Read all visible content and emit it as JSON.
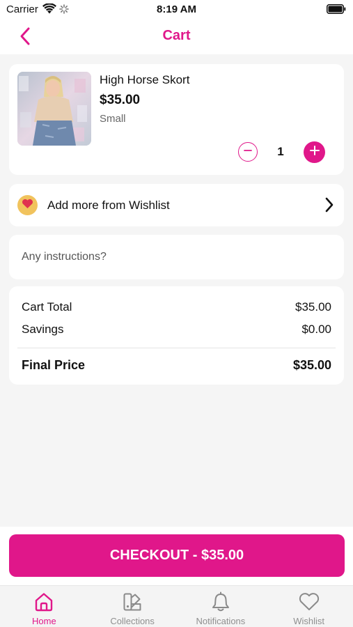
{
  "status_bar": {
    "carrier": "Carrier",
    "time": "8:19 AM"
  },
  "nav": {
    "title": "Cart",
    "back_icon": "chevron-left-icon"
  },
  "cart_item": {
    "name": "High Horse Skort",
    "price": "$35.00",
    "size": "Small",
    "quantity": "1"
  },
  "wishlist": {
    "label": "Add more from Wishlist",
    "icon": "heart-icon"
  },
  "instructions": {
    "placeholder": "Any instructions?"
  },
  "summary": {
    "cart_total_label": "Cart Total",
    "cart_total_value": "$35.00",
    "savings_label": "Savings",
    "savings_value": "$0.00",
    "final_label": "Final Price",
    "final_value": "$35.00"
  },
  "checkout": {
    "label": "CHECKOUT - $35.00"
  },
  "tabs": [
    {
      "label": "Home",
      "icon": "home-icon",
      "active": true
    },
    {
      "label": "Collections",
      "icon": "collections-icon",
      "active": false
    },
    {
      "label": "Notifications",
      "icon": "bell-icon",
      "active": false
    },
    {
      "label": "Wishlist",
      "icon": "heart-icon",
      "active": false
    }
  ],
  "colors": {
    "accent": "#e0178a",
    "background": "#f5f5f5",
    "card": "#ffffff",
    "badge": "#f1c35d"
  }
}
